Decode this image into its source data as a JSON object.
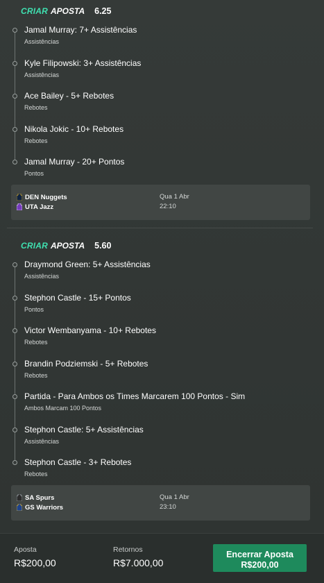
{
  "bets": [
    {
      "tag_criar": "CRIAR",
      "tag_aposta": "APOSTA",
      "odds": "6.25",
      "selections": [
        {
          "title": "Jamal Murray: 7+ Assistências",
          "sub": "Assistências"
        },
        {
          "title": "Kyle Filipowski: 3+ Assistências",
          "sub": "Assistências"
        },
        {
          "title": "Ace Bailey - 5+ Rebotes",
          "sub": "Rebotes"
        },
        {
          "title": "Nikola Jokic - 10+ Rebotes",
          "sub": "Rebotes"
        },
        {
          "title": "Jamal Murray - 20+ Pontos",
          "sub": "Pontos"
        }
      ],
      "event": {
        "home": "DEN Nuggets",
        "home_color": "#0e2240",
        "away": "UTA Jazz",
        "away_color": "#753bbd",
        "date": "Qua 1 Abr",
        "time": "22:10"
      }
    },
    {
      "tag_criar": "CRIAR",
      "tag_aposta": "APOSTA",
      "odds": "5.60",
      "selections": [
        {
          "title": "Draymond Green: 5+ Assistências",
          "sub": "Assistências"
        },
        {
          "title": "Stephon Castle - 15+ Pontos",
          "sub": "Pontos"
        },
        {
          "title": "Victor Wembanyama - 10+ Rebotes",
          "sub": "Rebotes"
        },
        {
          "title": "Brandin Podziemski - 5+ Rebotes",
          "sub": "Rebotes"
        },
        {
          "title": "Partida - Para Ambos os Times Marcarem 100 Pontos - Sim",
          "sub": "Ambos Marcam 100 Pontos"
        },
        {
          "title": "Stephon Castle: 5+ Assistências",
          "sub": "Assistências"
        },
        {
          "title": "Stephon Castle - 3+ Rebotes",
          "sub": "Rebotes"
        }
      ],
      "event": {
        "home": "SA Spurs",
        "home_color": "#c4ced4",
        "away": "GS Warriors",
        "away_color": "#1d428a",
        "date": "Qua 1 Abr",
        "time": "23:10"
      }
    }
  ],
  "footer": {
    "stake_label": "Aposta",
    "stake_value": "R$200,00",
    "returns_label": "Retornos",
    "returns_value": "R$7.000,00",
    "cashout_line1": "Encerrar Aposta",
    "cashout_line2": "R$200,00",
    "cashout_color": "#1e8a5c"
  },
  "colors": {
    "accent": "#3fe0b0",
    "panel": "#353a38",
    "event_box": "#414644"
  }
}
